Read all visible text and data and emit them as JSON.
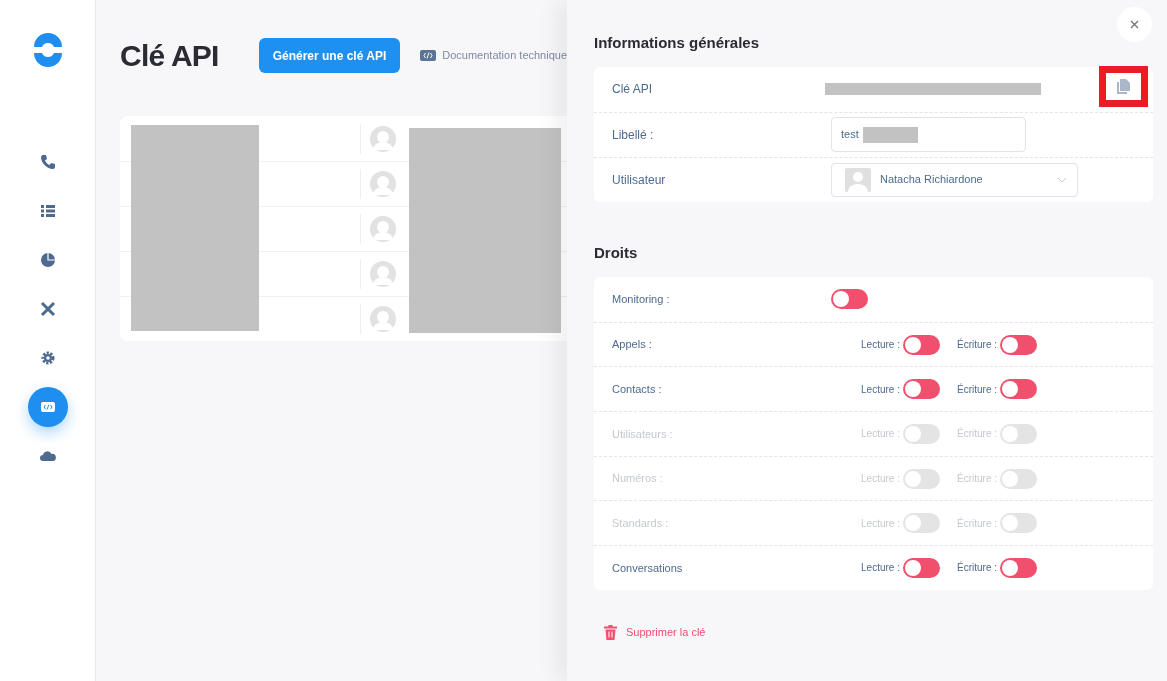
{
  "sidebar": {
    "items": [
      {
        "selected": false
      },
      {
        "selected": false
      },
      {
        "selected": false
      },
      {
        "selected": false
      },
      {
        "selected": false
      },
      {
        "selected": true
      },
      {
        "selected": false
      }
    ]
  },
  "page": {
    "title": "Clé API",
    "generate_button": "Générer une clé API",
    "doc_link": "Documentation technique"
  },
  "table": {
    "rows": [
      {
        "kind": "user"
      },
      {
        "kind": "user"
      },
      {
        "kind": "user"
      },
      {
        "kind": "user"
      },
      {
        "kind": "user"
      }
    ]
  },
  "panel": {
    "general_title": "Informations générales",
    "fields": [
      {
        "kind": "key",
        "label": "Clé API",
        "copy_highlighted": true
      },
      {
        "kind": "input",
        "label": "Libellé :",
        "value": "test"
      },
      {
        "kind": "select",
        "label": "Utilisateur",
        "value": "Natacha Richiardone"
      }
    ],
    "rights_title": "Droits",
    "rights": [
      {
        "kind": "single",
        "label": "Monitoring :",
        "disabled": false,
        "on": false
      },
      {
        "kind": "pair",
        "label": "Appels :",
        "disabled": false,
        "read": {
          "label": "Lecture :",
          "on": false
        },
        "write": {
          "label": "Écriture :",
          "on": false
        }
      },
      {
        "kind": "pair",
        "label": "Contacts :",
        "disabled": false,
        "read": {
          "label": "Lecture :",
          "on": false
        },
        "write": {
          "label": "Écriture :",
          "on": false
        }
      },
      {
        "kind": "pair",
        "label": "Utilisateurs :",
        "disabled": true,
        "read": {
          "label": "Lecture :",
          "on": false
        },
        "write": {
          "label": "Écriture :",
          "on": false
        }
      },
      {
        "kind": "pair",
        "label": "Numéros :",
        "disabled": true,
        "read": {
          "label": "Lecture :",
          "on": false
        },
        "write": {
          "label": "Écriture :",
          "on": false
        }
      },
      {
        "kind": "pair",
        "label": "Standards :",
        "disabled": true,
        "read": {
          "label": "Lecture :",
          "on": false
        },
        "write": {
          "label": "Écriture :",
          "on": false
        }
      },
      {
        "kind": "pair",
        "label": "Conversations",
        "disabled": false,
        "read": {
          "label": "Lecture :",
          "on": false
        },
        "write": {
          "label": "Écriture :",
          "on": false
        }
      }
    ],
    "delete_link": "Supprimer la clé"
  }
}
